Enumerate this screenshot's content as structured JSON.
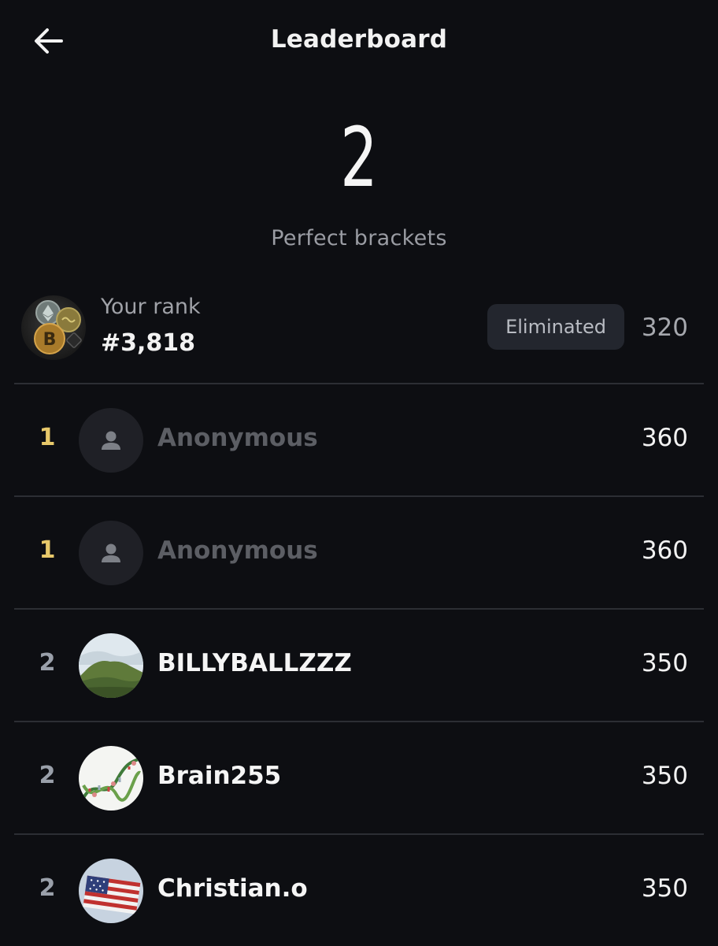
{
  "header": {
    "title": "Leaderboard",
    "back_icon": "arrow-left-icon"
  },
  "summary": {
    "count": "2",
    "label": "Perfect brackets"
  },
  "my_rank": {
    "label": "Your rank",
    "value": "#3,818",
    "status": "Eliminated",
    "score": "320"
  },
  "colors": {
    "background": "#0d0e12",
    "gold_rank": "#e7c86a",
    "silver_rank": "#9aa0aa",
    "badge_bg": "#23262e"
  },
  "rows": [
    {
      "rank": "1",
      "name": "Anonymous",
      "score": "360",
      "avatar": "person-icon",
      "anonymous": true
    },
    {
      "rank": "1",
      "name": "Anonymous",
      "score": "360",
      "avatar": "person-icon",
      "anonymous": true
    },
    {
      "rank": "2",
      "name": "BILLYBALLZZZ",
      "score": "350",
      "avatar": "mountain-photo",
      "anonymous": false
    },
    {
      "rank": "2",
      "name": "Brain255",
      "score": "350",
      "avatar": "dna-photo",
      "anonymous": false
    },
    {
      "rank": "2",
      "name": "Christian.o",
      "score": "350",
      "avatar": "flag-photo",
      "anonymous": false
    }
  ]
}
